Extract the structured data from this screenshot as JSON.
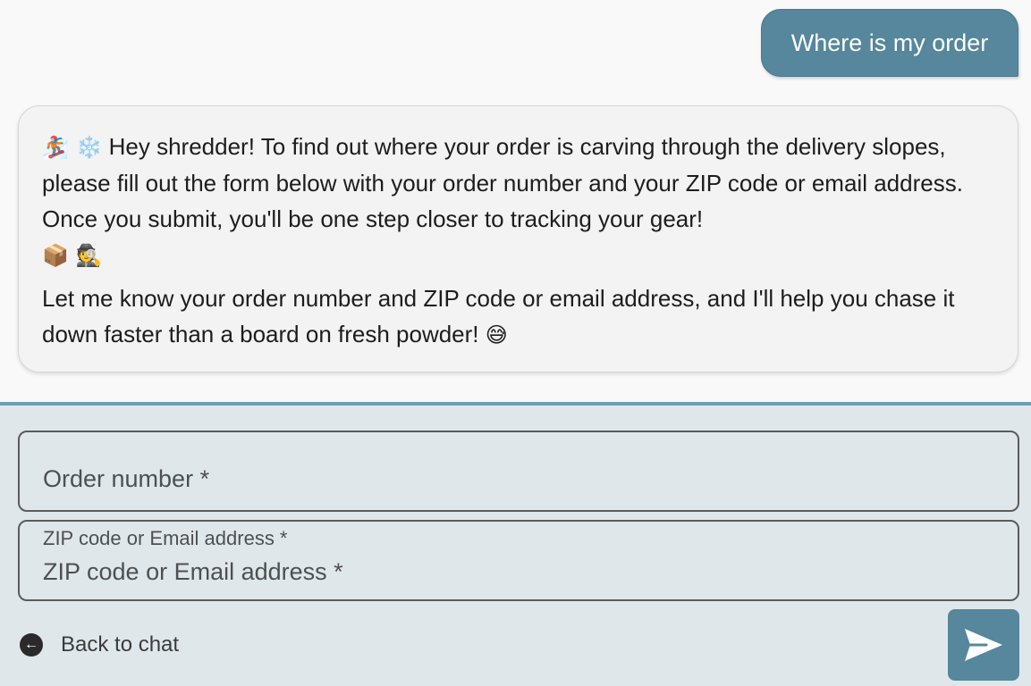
{
  "user_message": "Where is my order",
  "bot_message": {
    "line_emojis_start": "🏂 ❄️",
    "paragraph1": "Hey shredder! To find out where your order is carving through the delivery slopes, please fill out the form below with your order number and your ZIP code or email address. Once you submit, you'll be one step closer to tracking your gear!",
    "line_emojis_end": "📦 🕵️",
    "paragraph2": "Let me know your order number and ZIP code or email address, and I'll help you chase it down faster than a board on fresh powder!",
    "paragraph2_emoji": "😅"
  },
  "form": {
    "order_number_placeholder": "Order number *",
    "zip_email_label": "ZIP code or Email address *",
    "zip_email_placeholder": "ZIP code or Email address *",
    "order_number_value": "",
    "zip_email_value": ""
  },
  "back_link": {
    "label": "Back to chat",
    "icon": "arrow-left-circle-icon"
  },
  "send_button": {
    "icon": "send-icon"
  },
  "colors": {
    "accent": "#56879c",
    "form_background": "#e0e7eb",
    "chat_background": "#f9f9f9"
  }
}
